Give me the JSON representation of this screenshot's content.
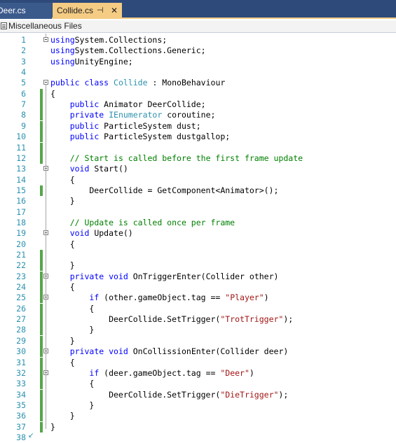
{
  "tabs": {
    "inactive_label": "Deer.cs",
    "active_label": "Collide.cs",
    "pin_glyph": "⊣",
    "close_glyph": "✕"
  },
  "navbar": {
    "label": "Miscellaneous Files"
  },
  "lines": [
    {
      "n": "1",
      "tokens": [
        [
          "kw",
          "using"
        ],
        [
          "",
          "System.Collections;"
        ]
      ]
    },
    {
      "n": "2",
      "tokens": [
        [
          "kw",
          "using"
        ],
        [
          "",
          "System.Collections.Generic;"
        ]
      ]
    },
    {
      "n": "3",
      "tokens": [
        [
          "kw",
          "using"
        ],
        [
          "",
          "UnityEngine;"
        ]
      ]
    },
    {
      "n": "4",
      "tokens": []
    },
    {
      "n": "5",
      "tokens": [
        [
          "kw",
          "public"
        ],
        [
          "",
          " "
        ],
        [
          "kw",
          "class"
        ],
        [
          "",
          " "
        ],
        [
          "ty",
          "Collide"
        ],
        [
          "",
          " : MonoBehaviour"
        ]
      ]
    },
    {
      "n": "6",
      "tokens": [
        [
          "",
          "{"
        ]
      ]
    },
    {
      "n": "7",
      "tokens": [
        [
          "",
          "    "
        ],
        [
          "kw",
          "public"
        ],
        [
          "",
          " Animator DeerCollide;"
        ]
      ]
    },
    {
      "n": "8",
      "tokens": [
        [
          "",
          "    "
        ],
        [
          "kw",
          "private"
        ],
        [
          "",
          " "
        ],
        [
          "ty",
          "IEnumerator"
        ],
        [
          "",
          " coroutine;"
        ]
      ]
    },
    {
      "n": "9",
      "tokens": [
        [
          "",
          "    "
        ],
        [
          "kw",
          "public"
        ],
        [
          "",
          " ParticleSystem dust;"
        ]
      ]
    },
    {
      "n": "10",
      "tokens": [
        [
          "",
          "    "
        ],
        [
          "kw",
          "public"
        ],
        [
          "",
          " ParticleSystem dustgallop;"
        ]
      ]
    },
    {
      "n": "11",
      "tokens": []
    },
    {
      "n": "12",
      "tokens": [
        [
          "",
          "    "
        ],
        [
          "cm",
          "// Start is called before the first frame update"
        ]
      ]
    },
    {
      "n": "13",
      "tokens": [
        [
          "",
          "    "
        ],
        [
          "kw",
          "void"
        ],
        [
          "",
          " Start()"
        ]
      ]
    },
    {
      "n": "14",
      "tokens": [
        [
          "",
          "    {"
        ]
      ]
    },
    {
      "n": "15",
      "tokens": [
        [
          "",
          "        DeerCollide = GetComponent<Animator>();"
        ]
      ]
    },
    {
      "n": "16",
      "tokens": [
        [
          "",
          "    }"
        ]
      ]
    },
    {
      "n": "17",
      "tokens": []
    },
    {
      "n": "18",
      "tokens": [
        [
          "",
          "    "
        ],
        [
          "cm",
          "// Update is called once per frame"
        ]
      ]
    },
    {
      "n": "19",
      "tokens": [
        [
          "",
          "    "
        ],
        [
          "kw",
          "void"
        ],
        [
          "",
          " Update()"
        ]
      ]
    },
    {
      "n": "20",
      "tokens": [
        [
          "",
          "    {"
        ]
      ]
    },
    {
      "n": "21",
      "tokens": []
    },
    {
      "n": "22",
      "tokens": [
        [
          "",
          "    }"
        ]
      ]
    },
    {
      "n": "23",
      "tokens": [
        [
          "",
          "    "
        ],
        [
          "kw",
          "private"
        ],
        [
          "",
          " "
        ],
        [
          "kw",
          "void"
        ],
        [
          "",
          " OnTriggerEnter(Collider other)"
        ]
      ]
    },
    {
      "n": "24",
      "tokens": [
        [
          "",
          "    {"
        ]
      ]
    },
    {
      "n": "25",
      "tokens": [
        [
          "",
          "        "
        ],
        [
          "kw",
          "if"
        ],
        [
          "",
          " (other.gameObject.tag == "
        ],
        [
          "str",
          "\"Player\""
        ],
        [
          "",
          ")"
        ]
      ]
    },
    {
      "n": "26",
      "tokens": [
        [
          "",
          "        {"
        ]
      ]
    },
    {
      "n": "27",
      "tokens": [
        [
          "",
          "            DeerCollide.SetTrigger("
        ],
        [
          "str",
          "\"TrotTrigger\""
        ],
        [
          "",
          ");"
        ]
      ]
    },
    {
      "n": "28",
      "tokens": [
        [
          "",
          "        }"
        ]
      ]
    },
    {
      "n": "29",
      "tokens": [
        [
          "",
          "    }"
        ]
      ]
    },
    {
      "n": "30",
      "tokens": [
        [
          "",
          "    "
        ],
        [
          "kw",
          "private"
        ],
        [
          "",
          " "
        ],
        [
          "kw",
          "void"
        ],
        [
          "",
          " OnCollissionEnter(Collider deer)"
        ]
      ]
    },
    {
      "n": "31",
      "tokens": [
        [
          "",
          "    {"
        ]
      ]
    },
    {
      "n": "32",
      "tokens": [
        [
          "",
          "        "
        ],
        [
          "kw",
          "if"
        ],
        [
          "",
          " (deer.gameObject.tag == "
        ],
        [
          "str",
          "\"Deer\""
        ],
        [
          "",
          ")"
        ]
      ]
    },
    {
      "n": "33",
      "tokens": [
        [
          "",
          "        {"
        ]
      ]
    },
    {
      "n": "34",
      "tokens": [
        [
          "",
          "            DeerCollide.SetTrigger("
        ],
        [
          "str",
          "\"DieTrigger\""
        ],
        [
          "",
          ");"
        ]
      ]
    },
    {
      "n": "35",
      "tokens": [
        [
          "",
          "        }"
        ]
      ]
    },
    {
      "n": "36",
      "tokens": [
        [
          "",
          "    }"
        ]
      ]
    },
    {
      "n": "37",
      "tokens": [
        [
          "",
          "}"
        ]
      ]
    },
    {
      "n": "38",
      "tokens": []
    }
  ],
  "colors": {
    "keyword": "#0000ff",
    "type": "#2b91af",
    "string": "#a31515",
    "comment": "#008000",
    "change_bar": "#57a64a",
    "tab_active": "#f5cc84"
  }
}
